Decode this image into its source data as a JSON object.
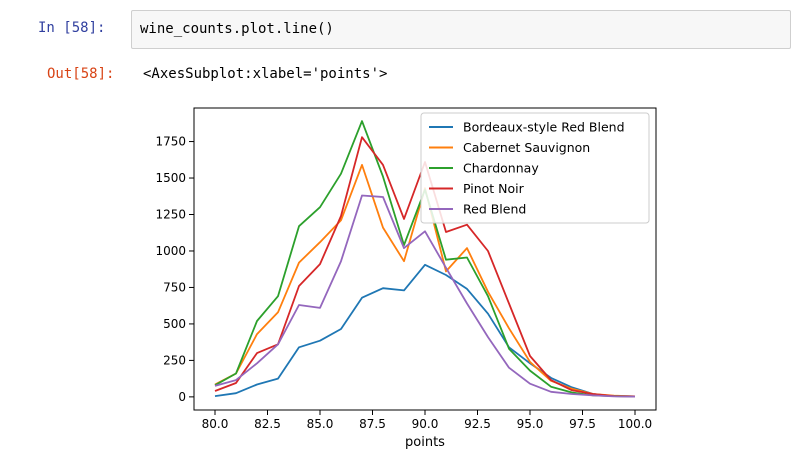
{
  "cell": {
    "in_prompt": "In  [58]:",
    "code": "wine_counts.plot.line()",
    "out_prompt": "Out[58]:",
    "output_text": "<AxesSubplot:xlabel='points'>"
  },
  "chart_data": {
    "type": "line",
    "title": "",
    "xlabel": "points",
    "ylabel": "",
    "xlim": [
      79.0,
      101.0
    ],
    "ylim": [
      -90,
      1980
    ],
    "grid": false,
    "legend_position": "top-right",
    "x_ticks": [
      80.0,
      82.5,
      85.0,
      87.5,
      90.0,
      92.5,
      95.0,
      97.5,
      100.0
    ],
    "x_tick_labels": [
      "80.0",
      "82.5",
      "85.0",
      "87.5",
      "90.0",
      "92.5",
      "95.0",
      "97.5",
      "100.0"
    ],
    "y_ticks": [
      0,
      250,
      500,
      750,
      1000,
      1250,
      1500,
      1750
    ],
    "y_tick_labels": [
      "0",
      "250",
      "500",
      "750",
      "1000",
      "1250",
      "1500",
      "1750"
    ],
    "x": [
      80,
      81,
      82,
      83,
      84,
      85,
      86,
      87,
      88,
      89,
      90,
      91,
      92,
      93,
      94,
      95,
      96,
      97,
      98,
      99,
      100
    ],
    "series": [
      {
        "name": "Bordeaux-style Red Blend",
        "color": "#1f77b4",
        "values": [
          5,
          25,
          85,
          125,
          340,
          385,
          465,
          680,
          745,
          730,
          905,
          835,
          740,
          570,
          340,
          230,
          130,
          65,
          20,
          5,
          3
        ]
      },
      {
        "name": "Cabernet Sauvignon",
        "color": "#ff7f0e",
        "values": [
          85,
          160,
          430,
          580,
          920,
          1060,
          1210,
          1590,
          1160,
          930,
          1430,
          860,
          1020,
          720,
          470,
          240,
          110,
          55,
          20,
          8,
          3
        ]
      },
      {
        "name": "Chardonnay",
        "color": "#2ca02c",
        "values": [
          80,
          160,
          520,
          690,
          1170,
          1300,
          1530,
          1890,
          1510,
          1040,
          1420,
          940,
          955,
          690,
          330,
          180,
          70,
          30,
          10,
          5,
          3
        ]
      },
      {
        "name": "Pinot Noir",
        "color": "#d62728",
        "values": [
          40,
          95,
          300,
          360,
          760,
          910,
          1240,
          1780,
          1590,
          1220,
          1610,
          1130,
          1180,
          1000,
          640,
          280,
          115,
          45,
          20,
          5,
          3
        ]
      },
      {
        "name": "Red Blend",
        "color": "#9467bd",
        "values": [
          75,
          115,
          230,
          360,
          630,
          610,
          930,
          1380,
          1370,
          1020,
          1135,
          885,
          640,
          410,
          200,
          90,
          35,
          20,
          10,
          3,
          2
        ]
      }
    ]
  }
}
